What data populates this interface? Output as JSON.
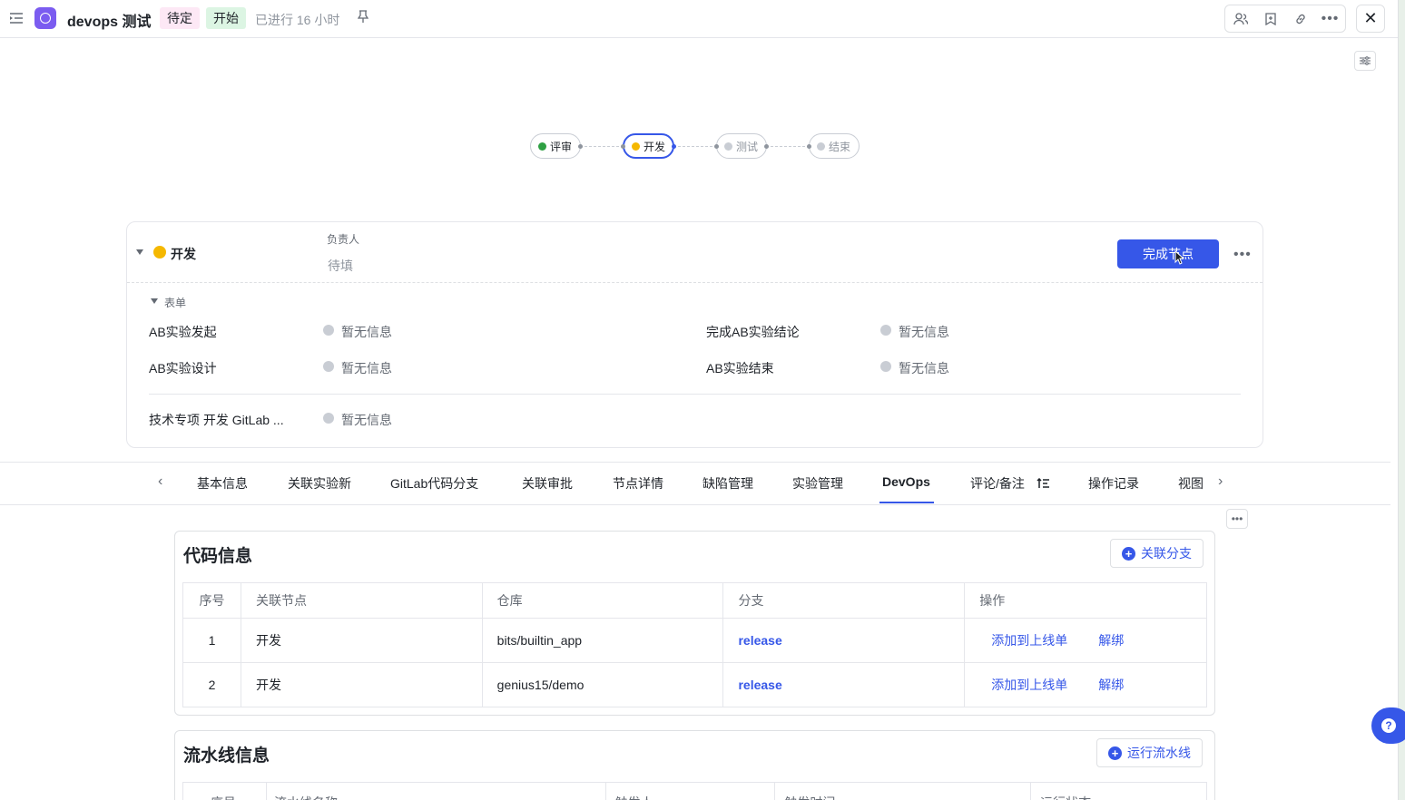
{
  "header": {
    "title": "devops 测试",
    "status_tag": "待定",
    "stage_tag": "开始",
    "elapsed": "已进行 16 小时",
    "pin_icon": "pin-icon",
    "actions": [
      "members-icon",
      "bookmark-icon",
      "link-icon",
      "more-icon"
    ],
    "close_icon": "close-icon"
  },
  "workflow": {
    "nodes": [
      {
        "label": "评审",
        "status_color": "#2ea043"
      },
      {
        "label": "开发",
        "status_color": "#f5b800"
      },
      {
        "label": "测试",
        "status_color": "#c9cdd4"
      },
      {
        "label": "结束",
        "status_color": "#c9cdd4"
      }
    ]
  },
  "node_card": {
    "name": "开发",
    "owner_label": "负责人",
    "owner_value": "待填",
    "complete_button": "完成节点",
    "form_section": "表单",
    "fields": [
      {
        "key": "AB实验发起",
        "value": "暂无信息"
      },
      {
        "key": "完成AB实验结论",
        "value": "暂无信息"
      },
      {
        "key": "AB实验设计",
        "value": "暂无信息"
      },
      {
        "key": "AB实验结束",
        "value": "暂无信息"
      },
      {
        "key": "技术专项 开发 GitLab ...",
        "value": "暂无信息"
      }
    ]
  },
  "tabs": [
    "基本信息",
    "关联实验新",
    "GitLab代码分支",
    "关联审批",
    "节点详情",
    "缺陷管理",
    "实验管理",
    "DevOps",
    "评论/备注",
    "操作记录",
    "视图"
  ],
  "active_tab": "DevOps",
  "code_section": {
    "title": "代码信息",
    "button": "关联分支",
    "columns": [
      "序号",
      "关联节点",
      "仓库",
      "分支",
      "操作"
    ],
    "rows": [
      {
        "no": "1",
        "node": "开发",
        "repo": "bits/builtin_app",
        "branch": "release",
        "action1": "添加到上线单",
        "action2": "解绑"
      },
      {
        "no": "2",
        "node": "开发",
        "repo": "genius15/demo",
        "branch": "release",
        "action1": "添加到上线单",
        "action2": "解绑"
      }
    ]
  },
  "pipeline_section": {
    "title": "流水线信息",
    "button": "运行流水线",
    "columns": [
      "序号",
      "流水线名称",
      "触发人",
      "触发时间",
      "运行状态"
    ]
  },
  "colors": {
    "accent": "#3657e8",
    "brand": "#7b5cf0"
  }
}
